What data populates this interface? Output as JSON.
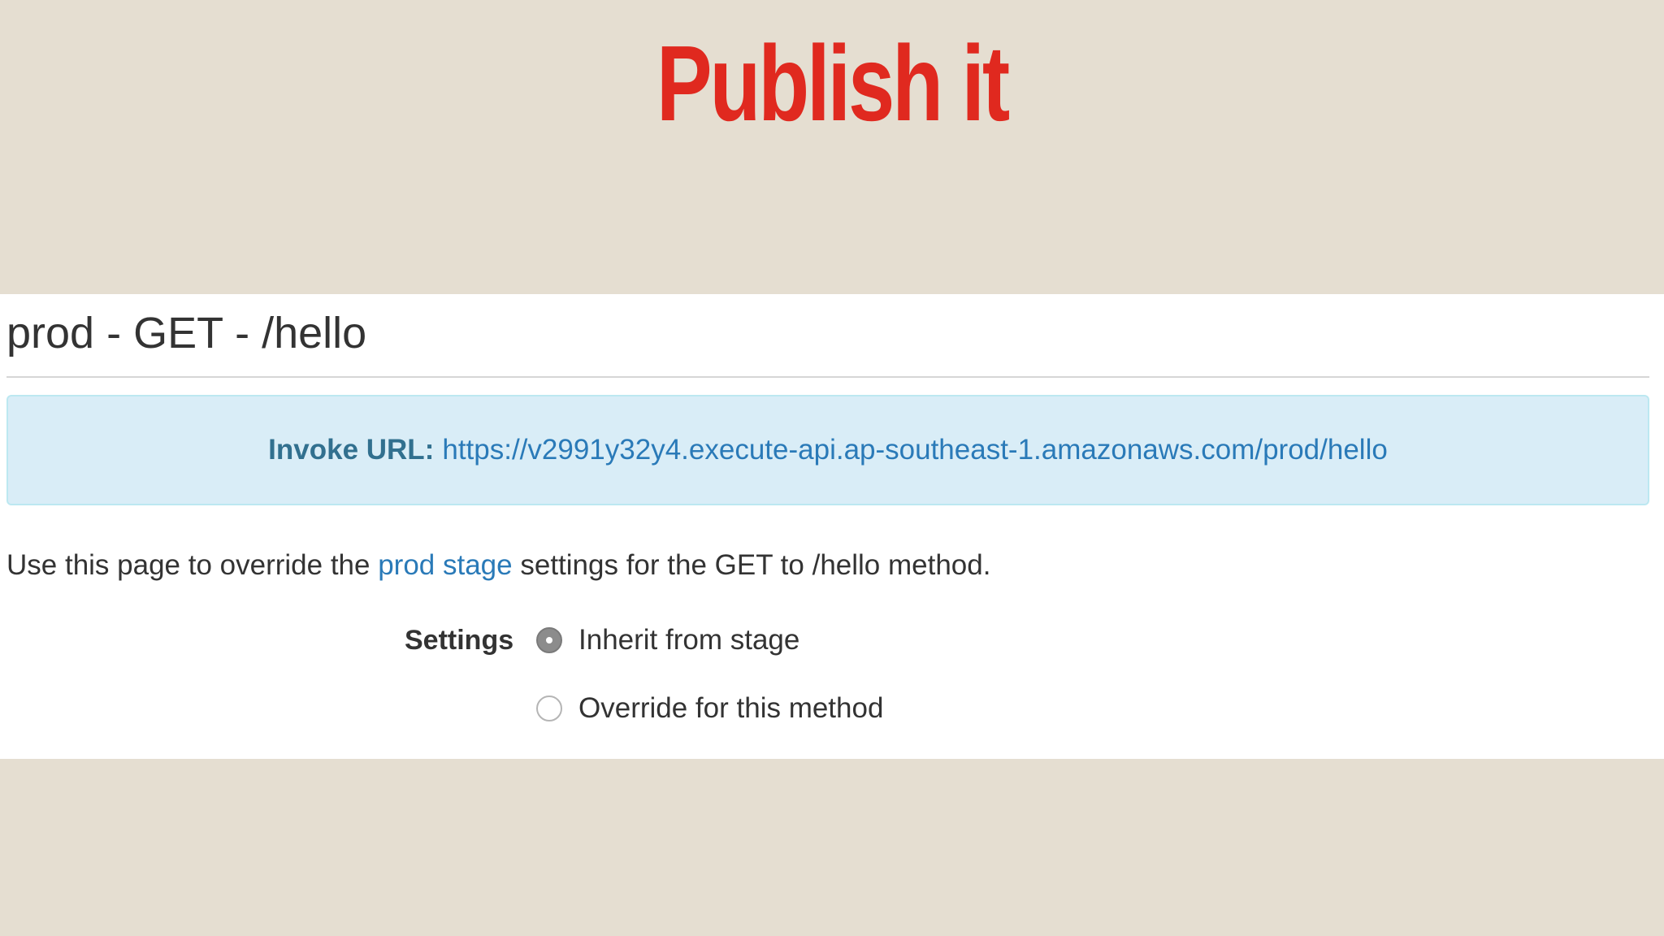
{
  "slide": {
    "title": "Publish it"
  },
  "panel": {
    "heading": "prod - GET - /hello",
    "invoke": {
      "label": "Invoke URL:",
      "url": "https://v2991y32y4.execute-api.ap-southeast-1.amazonaws.com/prod/hello"
    },
    "description": {
      "prefix": "Use this page to override the ",
      "link": "prod stage",
      "suffix": " settings for the GET to /hello method."
    },
    "settings": {
      "label": "Settings",
      "options": [
        {
          "label": "Inherit from stage",
          "selected": true
        },
        {
          "label": "Override for this method",
          "selected": false
        }
      ]
    }
  },
  "colors": {
    "background": "#e5ded1",
    "title_red": "#e0291f",
    "link_blue": "#2a7ab8",
    "info_bg": "#d9edf7",
    "info_border": "#bce8f1"
  }
}
